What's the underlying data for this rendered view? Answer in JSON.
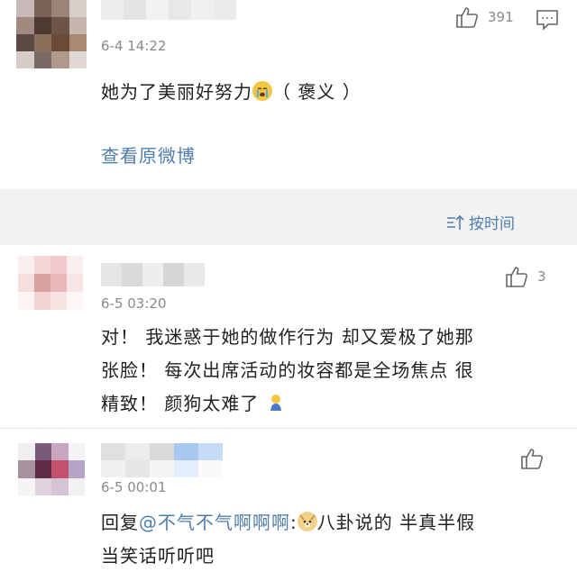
{
  "main_post": {
    "timestamp": "6-4 14:22",
    "like_count": "391",
    "text": "她为了美丽好努力",
    "text_suffix": "（ 褒义 ）",
    "emoji": "crying-face",
    "view_original": "查看原微博"
  },
  "sort": {
    "label": "按时间",
    "icon": "sort-icon"
  },
  "comments": [
    {
      "timestamp": "6-5 03:20",
      "like_count": "3",
      "text_lines": [
        "对！ 我迷惑于她的做作行为 却又爱极了她那",
        "张脸！ 每次出席活动的妆容都是全场焦点 很",
        "精致！ 颜狗太难了"
      ],
      "emoji": "kneeling-person"
    },
    {
      "timestamp": "6-5 00:01",
      "like_count": "",
      "reply_prefix": "回复",
      "mention": "@不气不气啊啊啊",
      "colon": ":",
      "emoji": "doge",
      "line1_rest": "八卦说的  半真半假",
      "line2": "当笑话听听吧"
    }
  ],
  "colors": {
    "link": "#507daf",
    "text": "#222222",
    "meta": "#8a8a8a",
    "background": "#f2f2f2"
  }
}
